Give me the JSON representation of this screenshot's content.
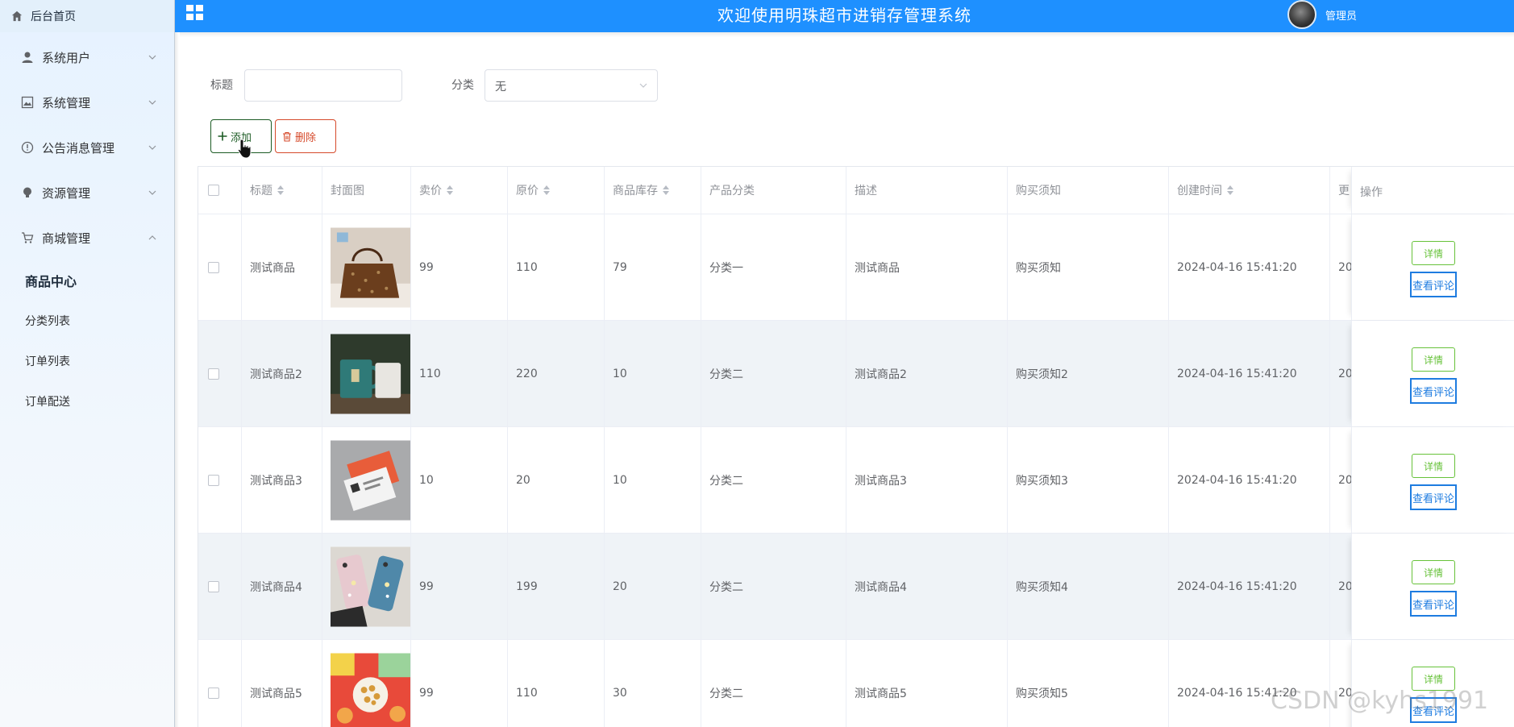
{
  "sidebar": {
    "home_label": "后台首页",
    "menus": [
      {
        "label": "系统用户",
        "icon": "user-icon"
      },
      {
        "label": "系统管理",
        "icon": "image-icon"
      },
      {
        "label": "公告消息管理",
        "icon": "info-icon"
      },
      {
        "label": "资源管理",
        "icon": "bulb-icon"
      },
      {
        "label": "商城管理",
        "icon": "cart-icon"
      }
    ],
    "sub_items": [
      "商品中心",
      "分类列表",
      "订单列表",
      "订单配送"
    ],
    "active_sub": "商品中心"
  },
  "header": {
    "title": "欢迎使用明珠超市进销存管理系统",
    "user": "管理员",
    "bg_color": "#1e90ff"
  },
  "filters": {
    "title_label": "标题",
    "title_value": "",
    "category_label": "分类",
    "category_value": "无"
  },
  "toolbar": {
    "add_label": "添加",
    "delete_label": "删除"
  },
  "table": {
    "headers": {
      "title": "标题",
      "cover": "封面图",
      "price": "卖价",
      "orig": "原价",
      "stock": "商品库存",
      "category": "产品分类",
      "desc": "描述",
      "notice": "购买须知",
      "created": "创建时间",
      "updated": "更",
      "ops": "操作"
    },
    "rows": [
      {
        "title": "测试商品",
        "price": "99",
        "orig": "110",
        "stock": "79",
        "category": "分类一",
        "desc": "测试商品",
        "notice": "购买须知",
        "created": "2024-04-16 15:41:20",
        "updated": "20"
      },
      {
        "title": "测试商品2",
        "price": "110",
        "orig": "220",
        "stock": "10",
        "category": "分类二",
        "desc": "测试商品2",
        "notice": "购买须知2",
        "created": "2024-04-16 15:41:20",
        "updated": "20"
      },
      {
        "title": "测试商品3",
        "price": "10",
        "orig": "20",
        "stock": "10",
        "category": "分类二",
        "desc": "测试商品3",
        "notice": "购买须知3",
        "created": "2024-04-16 15:41:20",
        "updated": "20"
      },
      {
        "title": "测试商品4",
        "price": "99",
        "orig": "199",
        "stock": "20",
        "category": "分类二",
        "desc": "测试商品4",
        "notice": "购买须知4",
        "created": "2024-04-16 15:41:20",
        "updated": "20"
      },
      {
        "title": "测试商品5",
        "price": "99",
        "orig": "110",
        "stock": "30",
        "category": "分类二",
        "desc": "测试商品5",
        "notice": "购买须知5",
        "created": "2024-04-16 15:41:20",
        "updated": "20"
      }
    ],
    "op_detail": "详情",
    "op_comment": "查看评论"
  },
  "watermark": "CSDN @kyhs1991"
}
